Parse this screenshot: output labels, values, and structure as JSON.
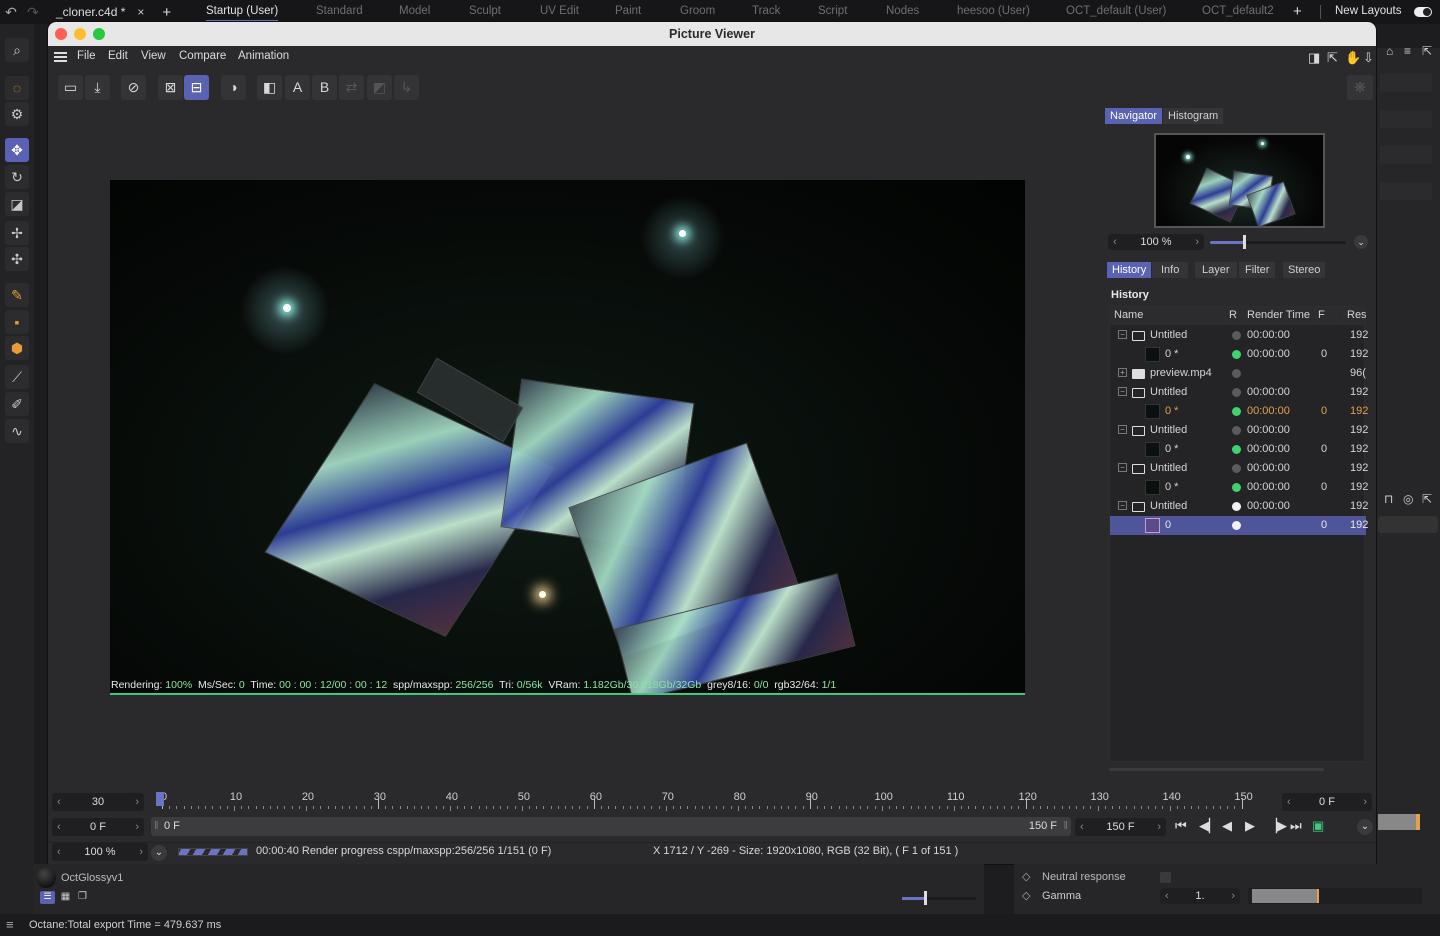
{
  "topbar": {
    "document_tab": "_cloner.c4d *",
    "layouts": [
      "Startup (User)",
      "Standard",
      "Model",
      "Sculpt",
      "UV Edit",
      "Paint",
      "Groom",
      "Track",
      "Script",
      "Nodes",
      "heesoo (User)",
      "OCT_default (User)",
      "OCT_default2"
    ],
    "active_layout": "Startup (User)",
    "new_layouts_label": "New Layouts",
    "new_layouts_enabled": true
  },
  "left_tools": [
    "search",
    "live-selection",
    "selection-tools",
    "move",
    "rotate",
    "scale",
    "transform",
    "soft-transform",
    "spline-pen",
    "spline-point",
    "spline-polygon",
    "paint-brush",
    "spline-line",
    "spline-sketch"
  ],
  "window": {
    "title": "Picture Viewer",
    "menu": [
      "File",
      "Edit",
      "View",
      "Compare",
      "Animation"
    ],
    "toolbar": [
      "open-file",
      "save-image",
      "stop-render",
      "render-region",
      "render-active",
      "channel-toggle",
      "compare-ab",
      "A",
      "B",
      "swap-ab",
      "overlay",
      "output"
    ]
  },
  "render_overlay": {
    "rendering_label": "Rendering:",
    "rendering_val": "100%",
    "ms_label": "Ms/Sec:",
    "ms_val": "0",
    "time_label": "Time:",
    "time_val": "00 : 00 : 12/00 : 00 : 12",
    "spp_label": "spp/maxspp:",
    "spp_val": "256/256",
    "tri_label": "Tri:",
    "tri_val": "0/56k",
    "vram_label": "VRam:",
    "vram_val": "1.182Gb/30.818Gb/32Gb",
    "grey_label": "grey8/16:",
    "grey_val": "0/0",
    "rgb_label": "rgb32/64:",
    "rgb_val": "1/1"
  },
  "navigator": {
    "tabs": [
      "Navigator",
      "Histogram"
    ],
    "active_tab": "Navigator",
    "zoom_value": "100 %",
    "zoom_slider_fraction": 0.25
  },
  "history_panel": {
    "tabs": [
      "History",
      "Info",
      "Layer",
      "Filter",
      "Stereo"
    ],
    "active_tab": "History",
    "heading": "History",
    "columns": [
      "Name",
      "R",
      "Render Time",
      "F",
      "Res"
    ],
    "rows": [
      {
        "type": "folder",
        "name": "Untitled",
        "status": "grey",
        "time": "00:00:00",
        "frame": "",
        "res": "192"
      },
      {
        "type": "image",
        "name": "0 *",
        "status": "green",
        "time": "00:00:00",
        "frame": "0",
        "res": "192"
      },
      {
        "type": "folder-filled",
        "name": "preview.mp4",
        "status": "grey",
        "time": "",
        "frame": "",
        "res": "96("
      },
      {
        "type": "folder",
        "name": "Untitled",
        "status": "grey",
        "time": "00:00:00",
        "frame": "",
        "res": "192"
      },
      {
        "type": "image",
        "name": "0 *",
        "status": "green",
        "time": "00:00:00",
        "frame": "0",
        "res": "192",
        "highlight": "orange"
      },
      {
        "type": "folder",
        "name": "Untitled",
        "status": "grey",
        "time": "00:00:00",
        "frame": "",
        "res": "192"
      },
      {
        "type": "image",
        "name": "0 *",
        "status": "green",
        "time": "00:00:00",
        "frame": "0",
        "res": "192"
      },
      {
        "type": "folder",
        "name": "Untitled",
        "status": "grey",
        "time": "00:00:00",
        "frame": "",
        "res": "192"
      },
      {
        "type": "image",
        "name": "0 *",
        "status": "green",
        "time": "00:00:00",
        "frame": "0",
        "res": "192"
      },
      {
        "type": "folder",
        "name": "Untitled",
        "status": "white",
        "time": "00:00:00",
        "frame": "",
        "res": "192"
      },
      {
        "type": "render",
        "name": "0",
        "status": "white",
        "time": "",
        "frame": "0",
        "res": "192",
        "selected": true
      }
    ]
  },
  "timeline": {
    "fps_value": "30",
    "start_frame": "0 F",
    "range_start": "0 F",
    "range_end": "150 F",
    "end_frame": "150 F",
    "current_frame": "0 F",
    "ruler_labels": [
      "0",
      "10",
      "20",
      "30",
      "40",
      "50",
      "60",
      "70",
      "80",
      "90",
      "100",
      "110",
      "120",
      "130",
      "140",
      "150"
    ],
    "ruler_max": 150,
    "zoom_value": "100 %",
    "render_progress_text": "00:00:40 Render progress  cspp/maxspp:256/256 1/151 (0 F)",
    "pixel_info": "X 1712 / Y -269 - Size: 1920x1080, RGB (32 Bit),  ( F 1 of 151 )"
  },
  "background": {
    "material_name": "OctGlossyv1",
    "neutral_response_label": "Neutral response",
    "gamma_label": "Gamma",
    "gamma_value": "1."
  },
  "statusbar": {
    "message": "Octane:Total export Time = 479.637 ms"
  },
  "colors": {
    "accent": "#5a62b4",
    "green": "#3fc97c",
    "orange": "#e5a04a"
  }
}
